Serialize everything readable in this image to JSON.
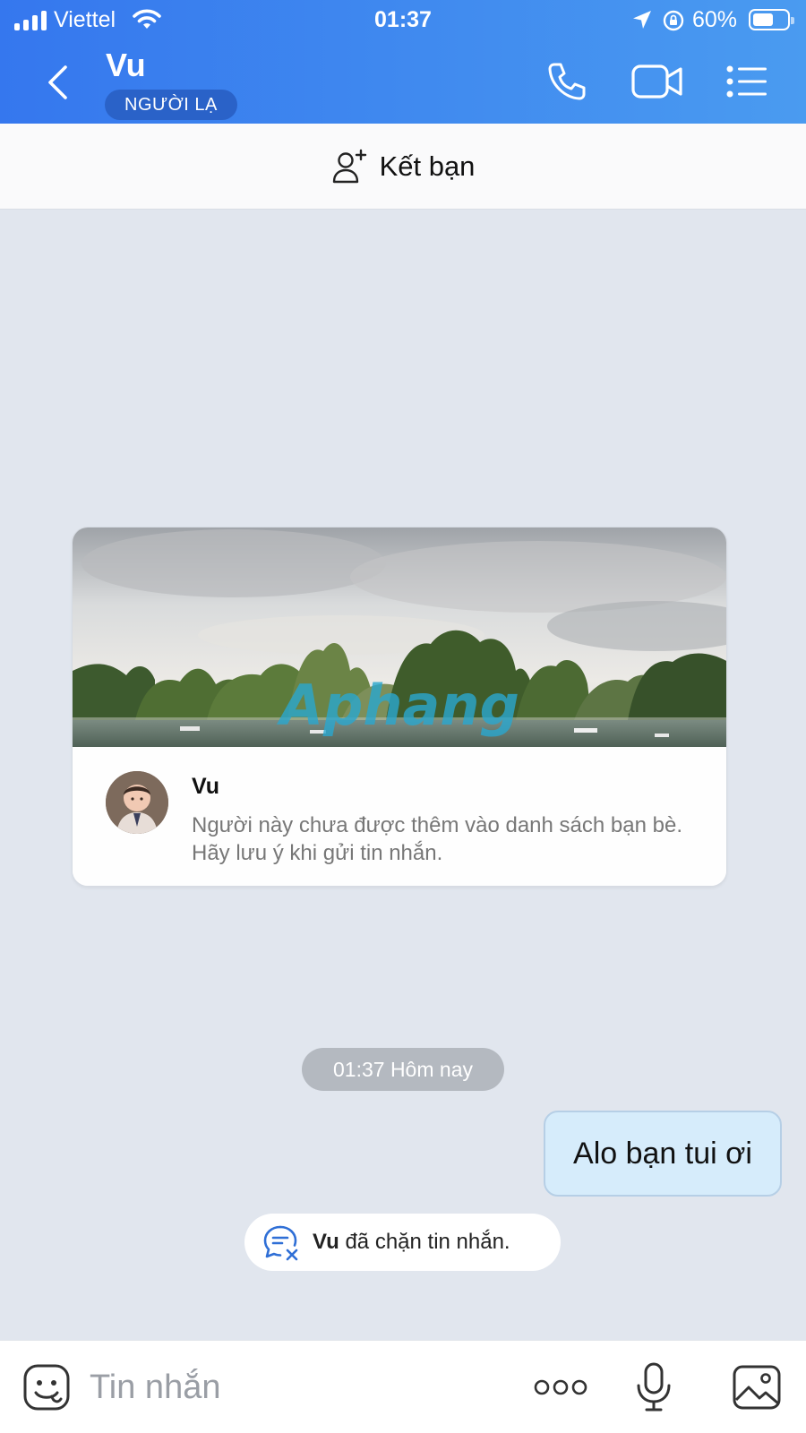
{
  "status_bar": {
    "carrier": "Viettel",
    "time": "01:37",
    "battery": "60%",
    "battery_level": 0.6
  },
  "header": {
    "name": "Vu",
    "badge": "NGƯỜI LẠ"
  },
  "add_friend": {
    "label": "Kết bạn"
  },
  "card": {
    "name": "Vu",
    "description": "Người này chưa được thêm vào danh sách bạn bè. Hãy lưu ý khi gửi tin nhắn.",
    "watermark": "Aphang"
  },
  "chat": {
    "time_label": "01:37 Hôm nay",
    "outgoing_message": "Alo bạn tui ơi",
    "blocked_name": "Vu",
    "blocked_text": " đã chặn tin nhắn."
  },
  "input": {
    "placeholder": "Tin nhắn"
  },
  "colors": {
    "header_start": "#3577ee",
    "header_end": "#4a9bf0",
    "chat_background": "#e1e6ee",
    "outgoing_bubble": "#d6ecfb"
  }
}
